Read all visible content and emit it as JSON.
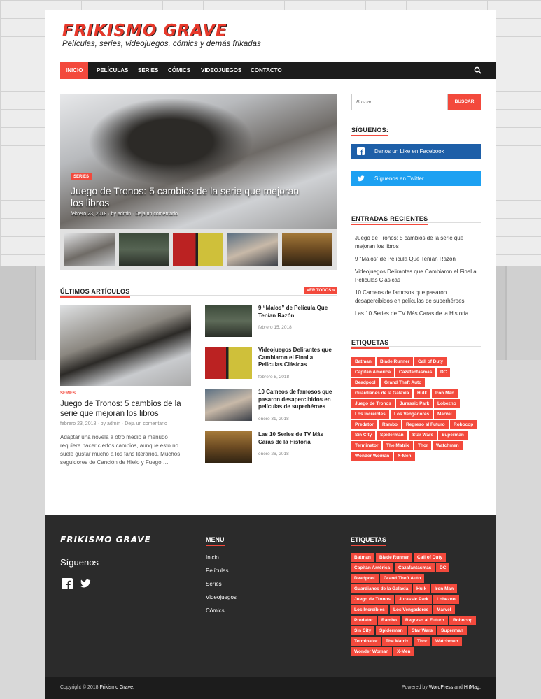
{
  "site": {
    "logo": "FRIKISMO GRAVE",
    "tagline": "Películas, series, videojuegos, cómics y demás frikadas"
  },
  "nav": {
    "items": [
      "INICIO",
      "PELÍCULAS",
      "SERIES",
      "CÓMICS",
      "VIDEOJUEGOS",
      "CONTACTO"
    ],
    "active": "INICIO",
    "search_icon": "search-icon"
  },
  "hero": {
    "category": "SERIES",
    "title": "Juego de Tronos: 5 cambios de la serie que mejoran los libros",
    "date": "febrero 23, 2018",
    "author": "by admin",
    "comment": "Deja un comentario"
  },
  "latest": {
    "heading": "ÚLTIMOS ARTÍCULOS",
    "view_all": "VER TODOS »",
    "featured": {
      "category": "SERIES",
      "title": "Juego de Tronos: 5 cambios de la serie que mejoran los libros",
      "date": "febrero 23, 2018",
      "author": "by admin",
      "comment": "Deja un comentario",
      "excerpt": "Adaptar una novela a otro medio a menudo requiere hacer ciertos cambios, aunque esto no suele gustar mucho a los fans literarios. Muchos seguidores de Canción de Hielo y Fuego …"
    },
    "articles": [
      {
        "title": "9 “Malos” de Película Que Tenían Razón",
        "date": "febrero 15, 2018"
      },
      {
        "title": "Videojuegos Delirantes que Cambiaron el Final a Películas Clásicas",
        "date": "febrero 8, 2018"
      },
      {
        "title": "10 Cameos de famosos que pasaron desapercibidos en películas de superhéroes",
        "date": "enero 31, 2018"
      },
      {
        "title": "Las 10 Series de TV Más Caras de la Historia",
        "date": "enero 26, 2018"
      }
    ]
  },
  "sidebar": {
    "search_placeholder": "Buscar …",
    "search_button": "BUSCAR",
    "follow_heading": "SÍGUENOS:",
    "facebook_label": "Danos un Like en Facebook",
    "twitter_label": "Síguenos en Twitter",
    "recent_heading": "ENTRADAS RECIENTES",
    "recent": [
      "Juego de Tronos: 5 cambios de la serie que mejoran los libros",
      "9 “Malos” de Película Que Tenían Razón",
      "Videojuegos Delirantes que Cambiaron el Final a Películas Clásicas",
      "10 Cameos de famosos que pasaron desapercibidos en películas de superhéroes",
      "Las 10 Series de TV Más Caras de la Historia"
    ],
    "tags_heading": "ETIQUETAS"
  },
  "tags": [
    "Batman",
    "Blade Runner",
    "Call of Duty",
    "Capitán América",
    "Cazafantasmas",
    "DC",
    "Deadpool",
    "Grand Theft Auto",
    "Guardianes de la Galaxia",
    "Hulk",
    "Iron Man",
    "Juego de Tronos",
    "Jurassic Park",
    "Lobezno",
    "Los Increíbles",
    "Los Vengadores",
    "Marvel",
    "Predator",
    "Rambo",
    "Regreso al Futuro",
    "Robocop",
    "Sin City",
    "Spiderman",
    "Star Wars",
    "Superman",
    "Terminator",
    "The Matrix",
    "Thor",
    "Watchmen",
    "Wonder Woman",
    "X-Men"
  ],
  "footer": {
    "logo": "FRIKISMO GRAVE",
    "follow": "Síguenos",
    "menu_heading": "MENU",
    "menu": [
      "Inicio",
      "Películas",
      "Series",
      "Videojuegos",
      "Cómics"
    ],
    "tags_heading": "ETIQUETAS",
    "copyright_prefix": "Copyright © 2018",
    "copyright_site": "Frikismo Grave.",
    "powered_prefix": "Powered by",
    "powered_wp": "WordPress",
    "powered_and": "and",
    "powered_theme": "HitMag."
  },
  "colors": {
    "accent": "#f3493c",
    "dark": "#1c1c1c",
    "footer": "#2b2b2b",
    "facebook": "#1e5fa8",
    "twitter": "#1da1f2"
  }
}
